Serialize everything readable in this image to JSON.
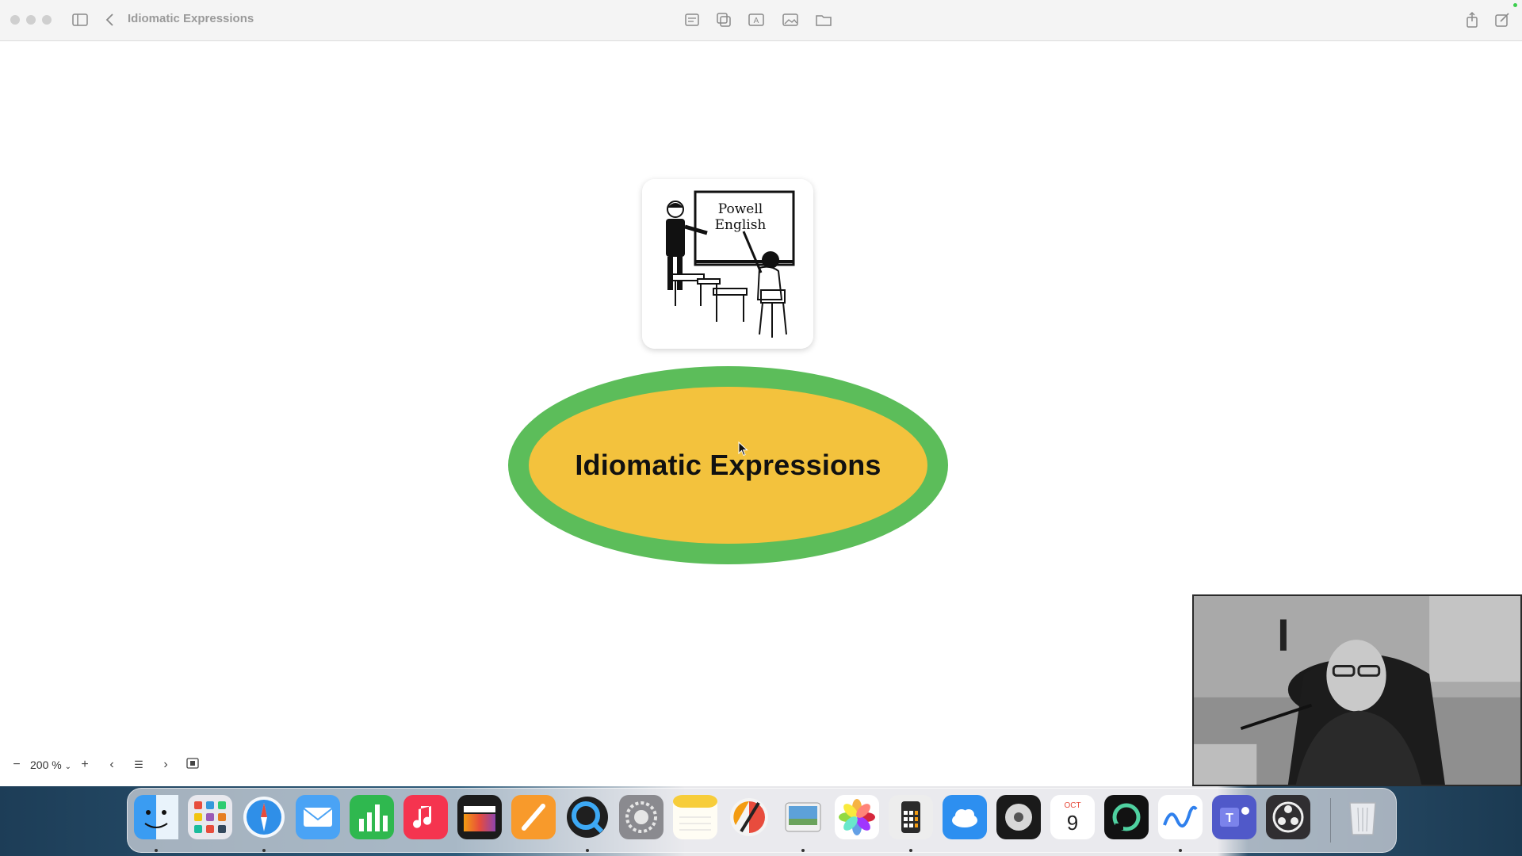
{
  "window": {
    "title": "Idiomatic Expressions"
  },
  "titlebar": {
    "left_icons": [
      "sidebar-toggle-icon",
      "back-chevron-icon"
    ],
    "center_icons": [
      "note-icon",
      "duplicate-icon",
      "text-box-icon",
      "image-icon",
      "folder-icon"
    ],
    "right_icons": [
      "share-icon",
      "compose-icon"
    ]
  },
  "canvas": {
    "image_card": {
      "caption_line1": "Powell",
      "caption_line2": "English"
    },
    "central_topic": {
      "label": "Idiomatic Expressions",
      "fill_color": "#f3c23d",
      "border_color": "#5cbd5a"
    }
  },
  "zoom_toolbar": {
    "zoom_out": "−",
    "zoom_value": "200 %",
    "zoom_in": "+",
    "prev": "‹",
    "outline": "☰",
    "next": "›"
  },
  "dock": {
    "apps": [
      {
        "name": "Finder",
        "icon": "finder-icon",
        "running": true
      },
      {
        "name": "Launchpad",
        "icon": "launchpad-icon",
        "running": false
      },
      {
        "name": "Safari",
        "icon": "safari-icon",
        "running": true
      },
      {
        "name": "Mail",
        "icon": "mail-icon",
        "running": false
      },
      {
        "name": "Numbers",
        "icon": "numbers-icon",
        "running": false
      },
      {
        "name": "Music",
        "icon": "music-icon",
        "running": false
      },
      {
        "name": "Final Cut Pro",
        "icon": "final-cut-icon",
        "running": false
      },
      {
        "name": "Pages",
        "icon": "pages-icon",
        "running": false
      },
      {
        "name": "QuickTime",
        "icon": "quicktime-icon",
        "running": true
      },
      {
        "name": "System Settings",
        "icon": "settings-icon",
        "running": false
      },
      {
        "name": "Notes",
        "icon": "notes-icon",
        "running": false
      },
      {
        "name": "Pixelmator",
        "icon": "pixelmator-icon",
        "running": false
      },
      {
        "name": "Preview",
        "icon": "preview-icon",
        "running": true
      },
      {
        "name": "Photos",
        "icon": "photos-icon",
        "running": false
      },
      {
        "name": "Calculator",
        "icon": "calculator-icon",
        "running": true
      },
      {
        "name": "Weather",
        "icon": "weather-icon",
        "running": false
      },
      {
        "name": "Compressor",
        "icon": "compressor-icon",
        "running": false
      },
      {
        "name": "Calendar",
        "icon": "calendar-icon",
        "running": false
      },
      {
        "name": "ChatGPT",
        "icon": "chatgpt-icon",
        "running": false
      },
      {
        "name": "Freeform",
        "icon": "freeform-icon",
        "running": true
      },
      {
        "name": "Teams",
        "icon": "teams-icon",
        "running": false
      },
      {
        "name": "OBS",
        "icon": "obs-icon",
        "running": false
      },
      {
        "name": "Trash",
        "icon": "trash-icon",
        "running": false
      }
    ],
    "calendar_month": "OCT",
    "calendar_day": "9"
  }
}
